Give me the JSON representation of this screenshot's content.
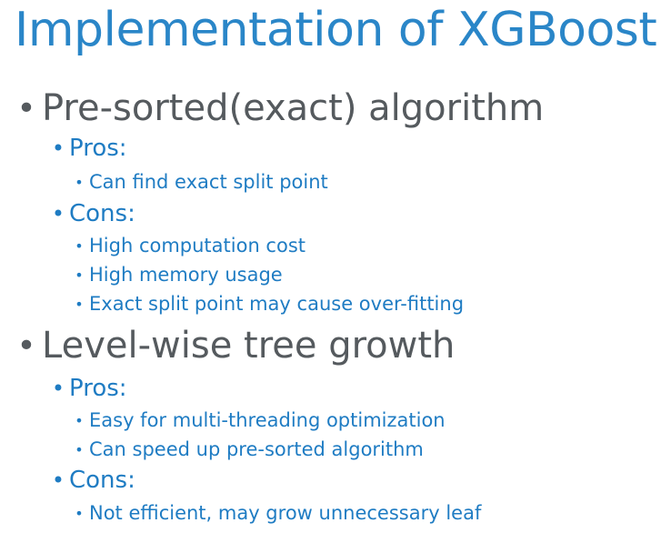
{
  "slide": {
    "title": "Implementation of XGBoost",
    "sections": [
      {
        "heading": "Pre-sorted(exact) algorithm",
        "groups": [
          {
            "label": "Pros:",
            "items": [
              "Can find exact split point"
            ]
          },
          {
            "label": "Cons:",
            "items": [
              "High computation cost",
              "High memory usage",
              "Exact split point may cause over-fitting"
            ]
          }
        ]
      },
      {
        "heading": "Level-wise tree growth",
        "groups": [
          {
            "label": "Pros:",
            "items": [
              "Easy for multi-threading optimization",
              "Can speed up pre-sorted algorithm"
            ]
          },
          {
            "label": "Cons:",
            "items": [
              "Not efficient, may grow unnecessary leaf"
            ]
          }
        ]
      }
    ],
    "bullet_glyph": "•",
    "colors": {
      "title": "#2a86c8",
      "level1_text": "#555a5e",
      "level2_text": "#1f7cc3",
      "level3_text": "#1f7cc3",
      "background": "#ffffff"
    }
  }
}
